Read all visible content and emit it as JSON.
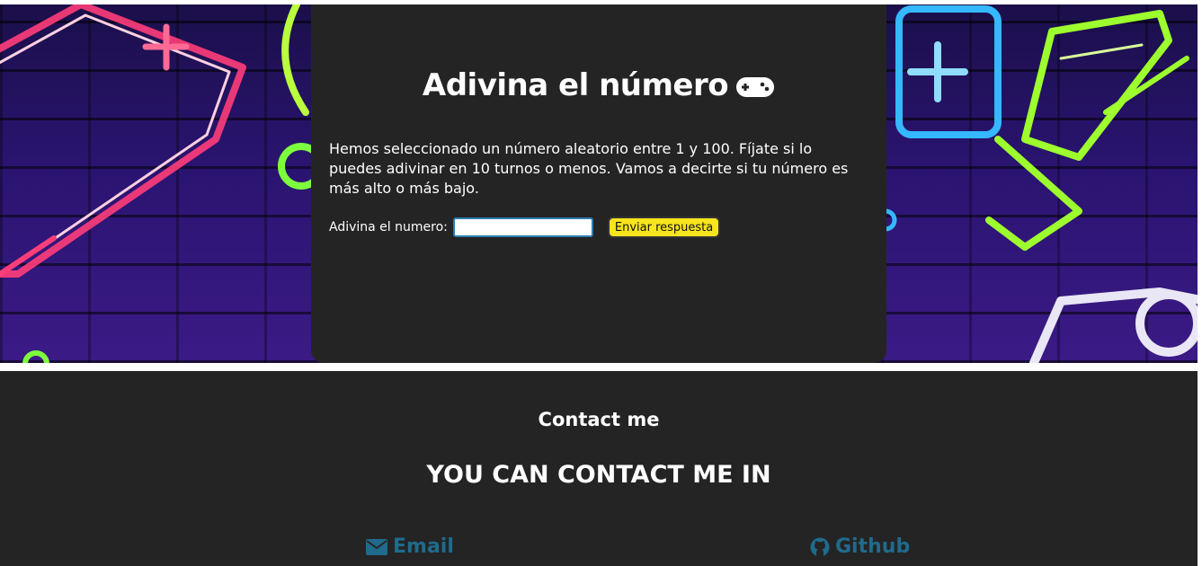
{
  "game": {
    "title": "Adivina el número",
    "title_icon": "gamepad-icon",
    "description": "Hemos seleccionado un número aleatorio entre 1 y 100. Fíjate si lo puedes adivinar en 10 turnos o menos. Vamos a decirte si tu número es más alto o más bajo.",
    "guess_label": "Adivina el numero:",
    "guess_value": "",
    "submit_label": "Enviar respuesta"
  },
  "footer": {
    "heading": "Contact me",
    "subheading": "YOU CAN CONTACT ME IN",
    "links": [
      {
        "label": "Email",
        "icon": "envelope-icon"
      },
      {
        "label": "Github",
        "icon": "github-icon"
      }
    ]
  },
  "colors": {
    "card_bg": "#242424",
    "submit_bg": "#f6e41c",
    "link": "#1f6b8c"
  }
}
